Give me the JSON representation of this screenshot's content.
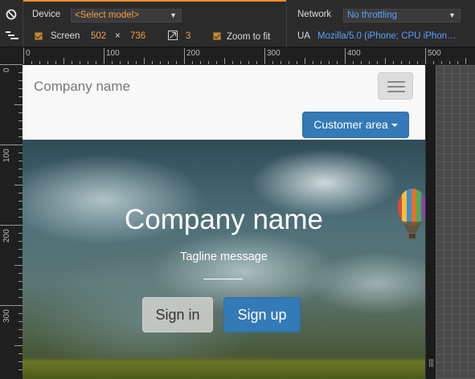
{
  "devtools": {
    "device_label": "Device",
    "device_select": "<Select model>",
    "screen_label": "Screen",
    "screen_width": "502",
    "screen_times": "×",
    "screen_height": "736",
    "device_pixel_ratio": "3",
    "zoom_label": "Zoom to fit",
    "network_label": "Network",
    "network_select": "No throttling",
    "ua_label": "UA",
    "ua_value": "Mozilla/5.0 (iPhone; CPU iPhon…",
    "colors": {
      "accent": "#f28c28",
      "value": "#f3a048",
      "link": "#5aa2ff"
    }
  },
  "rulers": {
    "top": [
      "0",
      "100",
      "200",
      "300",
      "400",
      "500"
    ],
    "left": [
      "0",
      "100",
      "200",
      "300"
    ]
  },
  "page": {
    "brand": "Company name",
    "customer_area": "Customer area",
    "hero_title": "Company name",
    "hero_tagline": "Tagline message",
    "sign_in": "Sign in",
    "sign_up": "Sign up",
    "colors": {
      "primary": "#337ab7",
      "navbar": "#f8f8f8"
    }
  }
}
